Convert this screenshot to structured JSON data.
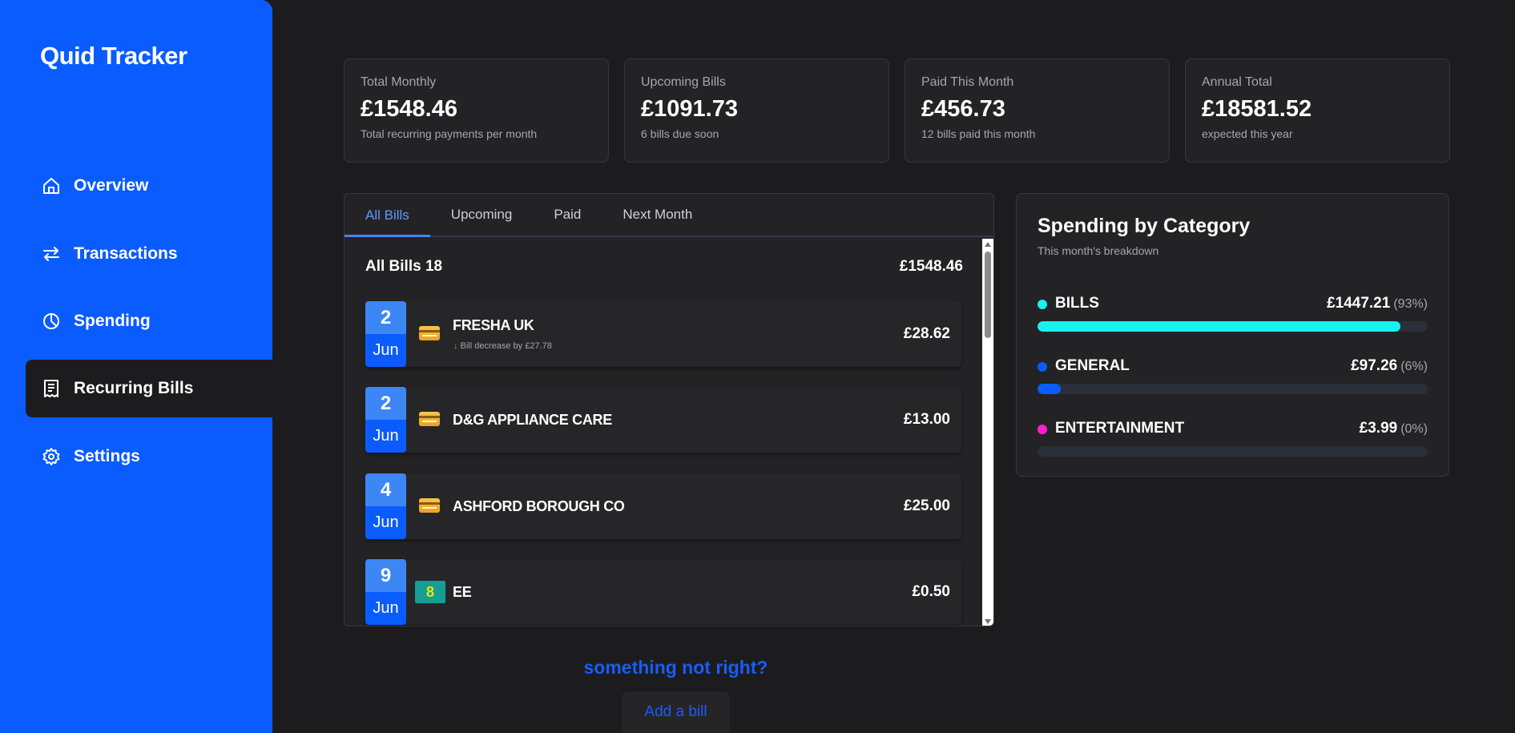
{
  "app": {
    "logo": "Quid Tracker"
  },
  "sidebar": {
    "items": [
      {
        "label": "Overview",
        "icon": "home-icon",
        "active": false
      },
      {
        "label": "Transactions",
        "icon": "arrows-swap-icon",
        "active": false
      },
      {
        "label": "Spending",
        "icon": "pie-chart-icon",
        "active": false
      },
      {
        "label": "Recurring Bills",
        "icon": "receipt-icon",
        "active": true
      },
      {
        "label": "Settings",
        "icon": "gear-icon",
        "active": false
      }
    ]
  },
  "stats": [
    {
      "label": "Total Monthly",
      "value": "£1548.46",
      "sub": "Total recurring payments per month"
    },
    {
      "label": "Upcoming Bills",
      "value": "£1091.73",
      "sub": "6 bills due soon"
    },
    {
      "label": "Paid This Month",
      "value": "£456.73",
      "sub": "12 bills paid this month"
    },
    {
      "label": "Annual Total",
      "value": "£18581.52",
      "sub": "expected this year"
    }
  ],
  "bills": {
    "tabs": [
      "All Bills",
      "Upcoming",
      "Paid",
      "Next Month"
    ],
    "active_tab": "All Bills",
    "header_title": "All Bills 18",
    "header_total": "£1548.46",
    "items": [
      {
        "day": "2",
        "month": "Jun",
        "name": "FRESHA UK",
        "amount": "£28.62",
        "note": "Bill decrease by £27.78",
        "icon": "card-icon"
      },
      {
        "day": "2",
        "month": "Jun",
        "name": "D&G APPLIANCE CARE",
        "amount": "£13.00",
        "note": "",
        "icon": "card-icon"
      },
      {
        "day": "4",
        "month": "Jun",
        "name": "ASHFORD BOROUGH CO",
        "amount": "£25.00",
        "note": "",
        "icon": "card-icon"
      },
      {
        "day": "9",
        "month": "Jun",
        "name": "EE",
        "amount": "£0.50",
        "note": "",
        "icon": "ee-logo-icon",
        "icon_text": "8"
      }
    ]
  },
  "categories": {
    "title": "Spending by Category",
    "subtitle": "This month's breakdown",
    "items": [
      {
        "name": "BILLS",
        "amount": "£1447.21",
        "pct": "(93%)",
        "fraction": 0.93,
        "color": "#19f0f0"
      },
      {
        "name": "GENERAL",
        "amount": "£97.26",
        "pct": "(6%)",
        "fraction": 0.06,
        "color": "#0a5cff"
      },
      {
        "name": "ENTERTAINMENT",
        "amount": "£3.99",
        "pct": "(0%)",
        "fraction": 0.0,
        "color": "#ff1fd2"
      }
    ]
  },
  "footer": {
    "prompt": "something not right?",
    "add_bill_label": "Add a bill"
  }
}
